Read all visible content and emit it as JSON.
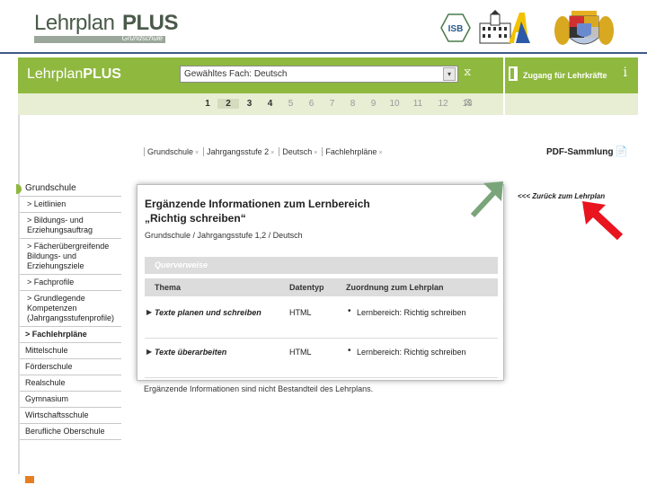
{
  "banner": {
    "logo_part1": "Lehrplan",
    "logo_part2": "PLUS",
    "logo_sub": "Grundschule",
    "isb": "ISB"
  },
  "appbar": {
    "title_part1": "Lehrplan",
    "title_part2": "PLUS",
    "subject_select_value": "Gewähltes Fach: Deutsch",
    "teacher_access": "Zugang für Lehrkräfte",
    "info": "i"
  },
  "grades": [
    {
      "label": "1",
      "state": "on"
    },
    {
      "label": "2",
      "state": "sel"
    },
    {
      "label": "3",
      "state": "on"
    },
    {
      "label": "4",
      "state": "on"
    },
    {
      "label": "5",
      "state": "off"
    },
    {
      "label": "6",
      "state": "off"
    },
    {
      "label": "7",
      "state": "off"
    },
    {
      "label": "8",
      "state": "off"
    },
    {
      "label": "9",
      "state": "off"
    },
    {
      "label": "10",
      "state": "off"
    },
    {
      "label": "11",
      "state": "off"
    },
    {
      "label": "12",
      "state": "off"
    },
    {
      "label": "13",
      "state": "off"
    }
  ],
  "breadcrumb": [
    "Grundschule",
    "Jahrgangsstufe 2",
    "Deutsch",
    "Fachlehrpläne"
  ],
  "breadcrumb_close": "×",
  "pdf_collection": "PDF-Sammlung",
  "leftnav": {
    "head": "Grundschule",
    "items": [
      {
        "label": "> Leitlinien",
        "kind": "sub"
      },
      {
        "label": "> Bildungs- und Erziehungsauftrag",
        "kind": "sub"
      },
      {
        "label": "> Fächerübergreifende Bildungs- und Erziehungsziele",
        "kind": "sub"
      },
      {
        "label": "> Fachprofile",
        "kind": "sub"
      },
      {
        "label": "> Grundlegende Kompetenzen (Jahrgangsstufenprofile)",
        "kind": "sub"
      },
      {
        "label": "> Fachlehrpläne",
        "kind": "active"
      },
      {
        "label": "Mittelschule",
        "kind": "top"
      },
      {
        "label": "Förderschule",
        "kind": "top"
      },
      {
        "label": "Realschule",
        "kind": "top"
      },
      {
        "label": "Gymnasium",
        "kind": "top"
      },
      {
        "label": "Wirtschaftsschule",
        "kind": "top"
      },
      {
        "label": "Berufliche Oberschule",
        "kind": "top"
      }
    ]
  },
  "popup": {
    "title": "Ergänzende Informationen zum Lernbereich „Richtig schreiben“",
    "subtitle": "Grundschule / Jahrgangsstufe 1,2 / Deutsch",
    "xref_label": "Querverweise",
    "columns": [
      "Thema",
      "Datentyp",
      "Zuordnung zum Lehrplan"
    ],
    "rows": [
      {
        "theme": "Texte planen und schreiben",
        "dtype": "HTML",
        "assign": "Lernbereich: Richtig schreiben"
      },
      {
        "theme": "Texte überarbeiten",
        "dtype": "HTML",
        "assign": "Lernbereich: Richtig schreiben"
      }
    ]
  },
  "back_link": "<<< Zurück zum Lehrplan",
  "footnote": "Ergänzende Informationen sind nicht Bestandteil des Lehrplans.",
  "colors": {
    "green": "#8fb83f",
    "pale_green": "#e7eed4",
    "arrow_green": "#7aa57a",
    "red_arrow": "#e8141e"
  },
  "icons": {
    "hourglass": "⧖",
    "dropdown": "▾",
    "pdf": "📄"
  }
}
